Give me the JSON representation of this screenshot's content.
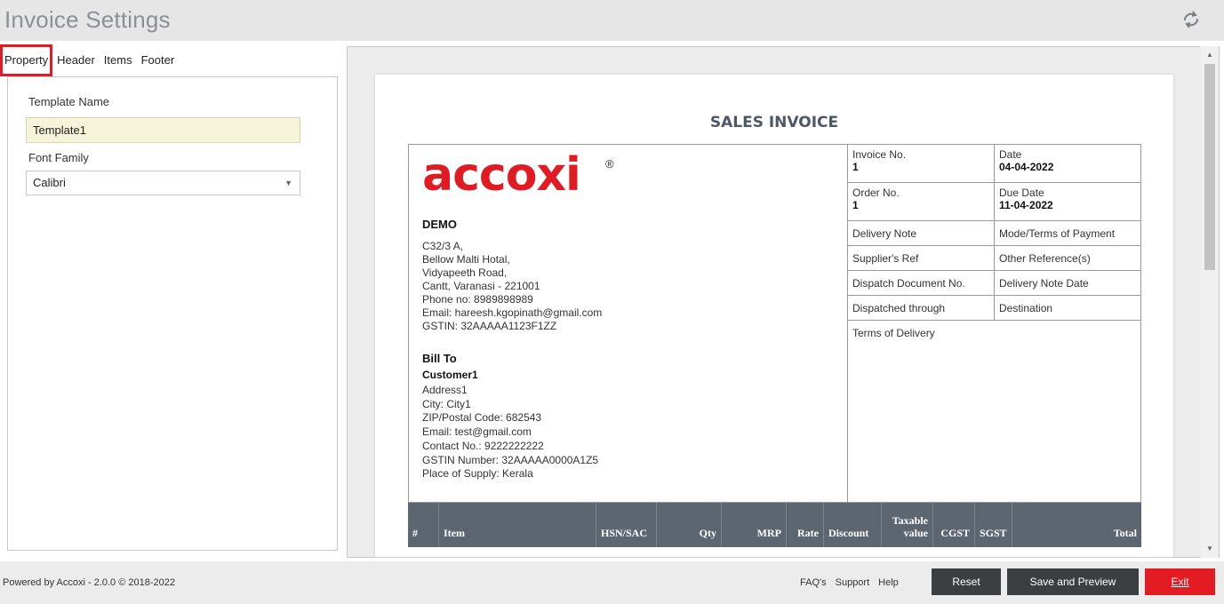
{
  "app": {
    "title": "Invoice Settings"
  },
  "tabs": [
    "Property",
    "Header",
    "Items",
    "Footer"
  ],
  "property": {
    "template_name_label": "Template Name",
    "template_name_value": "Template1",
    "font_family_label": "Font Family",
    "font_family_value": "Calibri"
  },
  "invoice": {
    "title": "SALES INVOICE",
    "logo_text": "accoxi",
    "logo_mark": "®",
    "company": "DEMO",
    "address_lines": [
      "C32/3 A,",
      "Bellow Malti Hotal,",
      "Vidyapeeth Road,",
      "Cantt, Varanasi - 221001",
      "Phone no: 8989898989",
      "Email: hareesh.kgopinath@gmail.com",
      "GSTIN: 32AAAAA1123F1ZZ"
    ],
    "bill_to_heading": "Bill To",
    "customer": "Customer1",
    "bill_to_lines": [
      "Address1",
      "City: City1",
      "ZIP/Postal Code: 682543",
      "Email: test@gmail.com",
      "Contact No.: 9222222222",
      "GSTIN Number: 32AAAAA0000A1Z5",
      "Place of Supply: Kerala"
    ],
    "fields": {
      "invoice_no_label": "Invoice No.",
      "invoice_no": "1",
      "date_label": "Date",
      "date": "04-04-2022",
      "order_no_label": "Order No.",
      "order_no": "1",
      "due_date_label": "Due Date",
      "due_date": "11-04-2022",
      "delivery_note": "Delivery Note",
      "mode_terms": "Mode/Terms of Payment",
      "suppliers_ref": "Supplier's Ref",
      "other_refs": "Other Reference(s)",
      "dispatch_doc": "Dispatch Document No.",
      "delivery_note_date": "Delivery Note Date",
      "dispatched_through": "Dispatched through",
      "destination": "Destination",
      "terms_delivery": "Terms of Delivery"
    },
    "columns": [
      "#",
      "Item",
      "HSN/SAC",
      "Qty",
      "MRP",
      "Rate",
      "Discount",
      "Taxable value",
      "CGST",
      "SGST",
      "Total"
    ]
  },
  "footer": {
    "powered": "Powered by Accoxi - 2.0.0 © 2018-2022",
    "links": [
      "FAQ's",
      "Support",
      "Help"
    ],
    "reset": "Reset",
    "save_preview": "Save and Preview",
    "exit": "Exit"
  },
  "colors": {
    "accent_red": "#e31b23",
    "dark_button": "#3c3f42",
    "table_header": "#5c6671"
  }
}
